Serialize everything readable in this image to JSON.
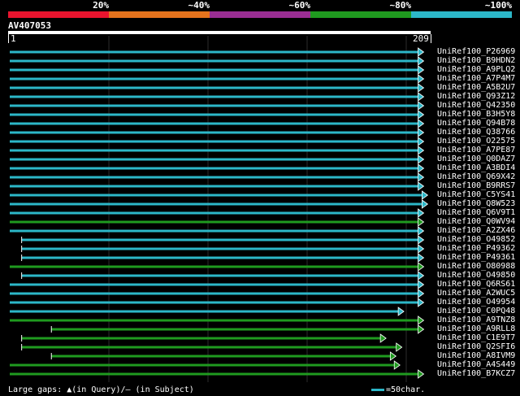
{
  "legend": {
    "segments": [
      {
        "label": "20%",
        "color": "#e8142e"
      },
      {
        "label": "~40%",
        "color": "#e5731d"
      },
      {
        "label": "~60%",
        "color": "#9a2e93"
      },
      {
        "label": "~80%",
        "color": "#1f9a1f"
      },
      {
        "label": "~100%",
        "color": "#2cb7c8"
      }
    ]
  },
  "query": {
    "name": "AV407053",
    "start": "1",
    "end": "209"
  },
  "hits": [
    {
      "name": "UniRef100_P26969",
      "start": 1,
      "end": 209,
      "color": "#2cb7c8"
    },
    {
      "name": "UniRef100_B9HDN2",
      "start": 1,
      "end": 209,
      "color": "#2cb7c8"
    },
    {
      "name": "UniRef100_A9PLQ2",
      "start": 1,
      "end": 209,
      "color": "#2cb7c8"
    },
    {
      "name": "UniRef100_A7P4M7",
      "start": 1,
      "end": 209,
      "color": "#2cb7c8"
    },
    {
      "name": "UniRef100_A5B2U7",
      "start": 1,
      "end": 209,
      "color": "#2cb7c8"
    },
    {
      "name": "UniRef100_Q93Z12",
      "start": 1,
      "end": 209,
      "color": "#2cb7c8"
    },
    {
      "name": "UniRef100_Q42350",
      "start": 1,
      "end": 209,
      "color": "#2cb7c8"
    },
    {
      "name": "UniRef100_B3H5Y8",
      "start": 1,
      "end": 209,
      "color": "#2cb7c8"
    },
    {
      "name": "UniRef100_Q94B78",
      "start": 1,
      "end": 209,
      "color": "#2cb7c8"
    },
    {
      "name": "UniRef100_Q38766",
      "start": 1,
      "end": 209,
      "color": "#2cb7c8"
    },
    {
      "name": "UniRef100_O22575",
      "start": 1,
      "end": 209,
      "color": "#2cb7c8"
    },
    {
      "name": "UniRef100_A7PE87",
      "start": 1,
      "end": 209,
      "color": "#2cb7c8"
    },
    {
      "name": "UniRef100_Q0DAZ7",
      "start": 1,
      "end": 209,
      "color": "#2cb7c8"
    },
    {
      "name": "UniRef100_A3BDI4",
      "start": 1,
      "end": 209,
      "color": "#2cb7c8"
    },
    {
      "name": "UniRef100_Q69X42",
      "start": 1,
      "end": 209,
      "color": "#2cb7c8"
    },
    {
      "name": "UniRef100_B9RRS7",
      "start": 1,
      "end": 209,
      "color": "#2cb7c8"
    },
    {
      "name": "UniRef100_C5YS41",
      "start": 1,
      "end": 211,
      "color": "#2cb7c8"
    },
    {
      "name": "UniRef100_Q8W523",
      "start": 1,
      "end": 211,
      "color": "#2cb7c8"
    },
    {
      "name": "UniRef100_Q6V9T1",
      "start": 1,
      "end": 209,
      "color": "#2cb7c8"
    },
    {
      "name": "UniRef100_Q0WV94",
      "start": 1,
      "end": 209,
      "color": "#1f9a1f"
    },
    {
      "name": "UniRef100_A2ZX46",
      "start": 1,
      "end": 209,
      "color": "#2cb7c8"
    },
    {
      "name": "UniRef100_O49852",
      "start": 7,
      "end": 209,
      "color": "#2cb7c8"
    },
    {
      "name": "UniRef100_P49362",
      "start": 7,
      "end": 209,
      "color": "#2cb7c8"
    },
    {
      "name": "UniRef100_P49361",
      "start": 7,
      "end": 209,
      "color": "#2cb7c8"
    },
    {
      "name": "UniRef100_O80988",
      "start": 1,
      "end": 209,
      "color": "#1f9a1f"
    },
    {
      "name": "UniRef100_O49850",
      "start": 7,
      "end": 209,
      "color": "#2cb7c8"
    },
    {
      "name": "UniRef100_Q6RS61",
      "start": 1,
      "end": 209,
      "color": "#2cb7c8"
    },
    {
      "name": "UniRef100_A2WUC5",
      "start": 1,
      "end": 209,
      "color": "#2cb7c8"
    },
    {
      "name": "UniRef100_O49954",
      "start": 1,
      "end": 209,
      "color": "#2cb7c8"
    },
    {
      "name": "UniRef100_C0PQ48",
      "start": 1,
      "end": 199,
      "color": "#2cb7c8"
    },
    {
      "name": "UniRef100_A9TNZ8",
      "start": 1,
      "end": 209,
      "color": "#1f9a1f"
    },
    {
      "name": "UniRef100_A9RLL8",
      "start": 22,
      "end": 209,
      "color": "#1f9a1f"
    },
    {
      "name": "UniRef100_C1E9T7",
      "start": 7,
      "end": 190,
      "color": "#1f9a1f"
    },
    {
      "name": "UniRef100_Q2SFI6",
      "start": 7,
      "end": 198,
      "color": "#1f9a1f"
    },
    {
      "name": "UniRef100_A8IVM9",
      "start": 22,
      "end": 195,
      "color": "#1f9a1f"
    },
    {
      "name": "UniRef100_A4S449",
      "start": 1,
      "end": 197,
      "color": "#1f9a1f"
    },
    {
      "name": "UniRef100_B7KCZ7",
      "start": 1,
      "end": 209,
      "color": "#1f9a1f"
    }
  ],
  "footer": {
    "gaps_text": "Large gaps: ▲(in Query)/— (in Subject)",
    "scale_text": "=50char."
  }
}
